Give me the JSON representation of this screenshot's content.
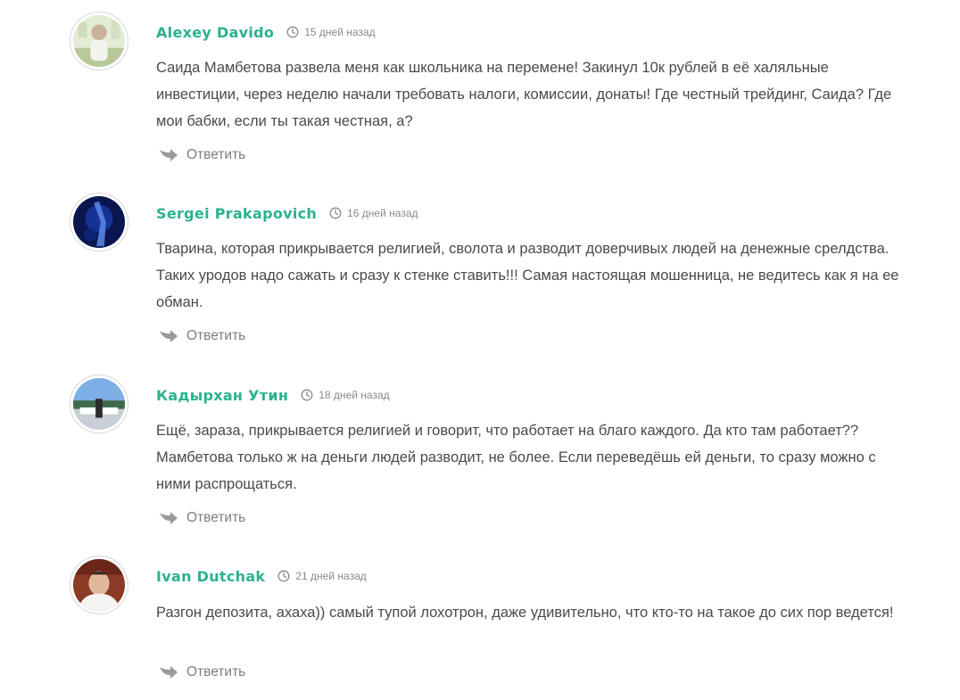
{
  "comments": [
    {
      "author": "Alexey Davido",
      "date": "15 дней назад",
      "text": "Саида Мамбетова развела меня как школьника на перемене! Закинул 10к рублей в её халяльные инвестиции, через неделю начали требовать налоги, комиссии, донаты! Где честный трейдинг, Саида? Где мои бабки, если ты такая честная, а?",
      "reply": "Ответить",
      "avatar_colors": [
        "#d6e3c4",
        "#a9c08e"
      ]
    },
    {
      "author": "Sergei Prakapovich",
      "date": "16 дней назад",
      "text": "Тварина, которая прикрывается религией, сволота и разводит доверчивых людей на денежные срелдства. Таких уродов надо сажать и сразу к стенке ставить!!! Самая настоящая мошенница, не ведитесь как я на ее обман.",
      "reply": "Ответить",
      "avatar_colors": [
        "#0b1a66",
        "#1f4fc4"
      ]
    },
    {
      "author": "Кадырхан Утин",
      "date": "18 дней назад",
      "text": "Ещё, зараза, прикрывается религией и говорит, что работает на благо каждого. Да кто там работает?? Мамбетова только ж на деньги людей разводит, не более. Если переведёшь ей деньги, то сразу можно с ними распрощаться.",
      "reply": "Ответить",
      "avatar_colors": [
        "#6d9bd6",
        "#2f4f3a"
      ]
    },
    {
      "author": "Ivan Dutchak",
      "date": "21 дней назад",
      "text": "Разгон депозита, ахаха)) самый тупой лохотрон, даже удивительно, что кто-то на такое до сих пор ведется!",
      "reply": "Ответить",
      "avatar_colors": [
        "#7a2f1e",
        "#e0b79a"
      ]
    }
  ],
  "colors": {
    "author": "#2bb28e",
    "text": "#4a4a4a",
    "meta": "#8a8a8a",
    "reply": "#7d7d7d"
  }
}
